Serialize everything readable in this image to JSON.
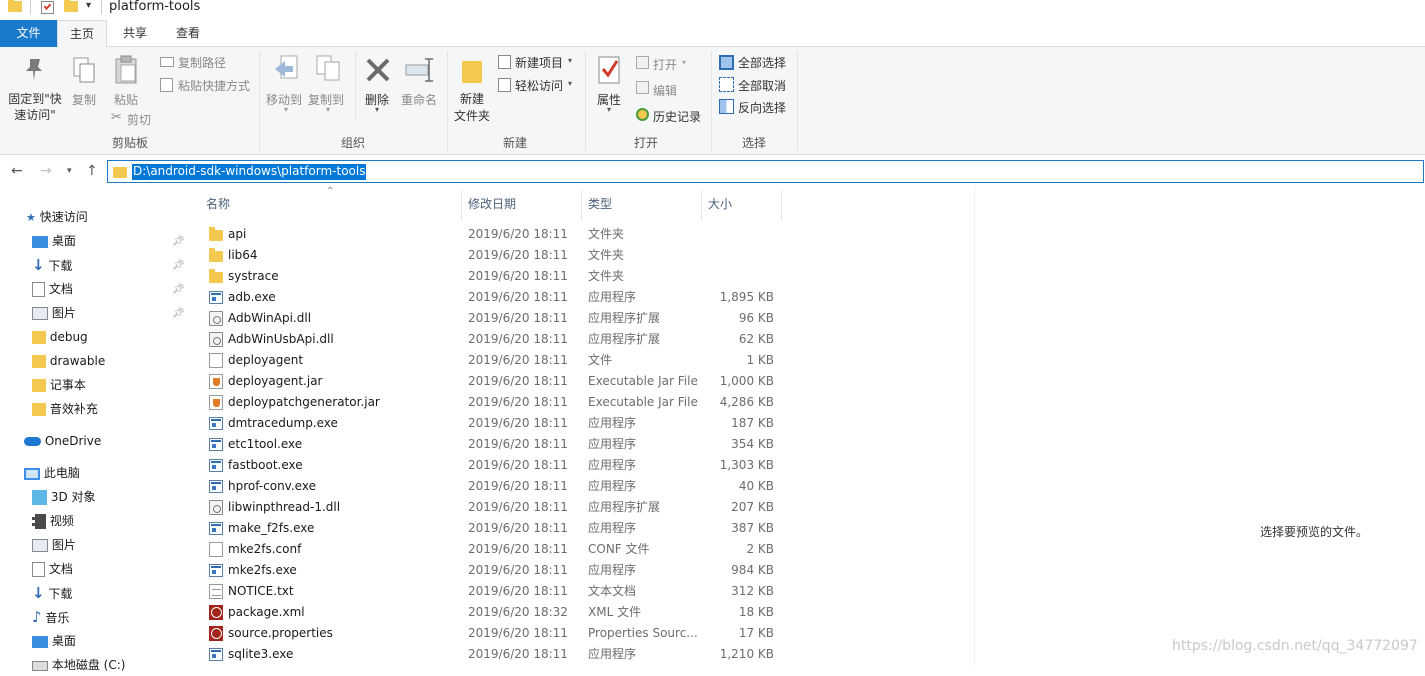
{
  "window": {
    "title": "platform-tools"
  },
  "tabs": {
    "file": "文件",
    "home": "主页",
    "share": "共享",
    "view": "查看"
  },
  "ribbon": {
    "clipboard": {
      "pin": "固定到\"快速访问\"",
      "copy": "复制",
      "paste": "粘贴",
      "copy_path": "复制路径",
      "paste_shortcut": "粘贴快捷方式",
      "cut": "剪切",
      "label": "剪贴板"
    },
    "organize": {
      "move_to": "移动到",
      "copy_to": "复制到",
      "delete": "删除",
      "rename": "重命名",
      "label": "组织"
    },
    "new": {
      "new_folder": "新建\n文件夹",
      "new_item": "新建项目",
      "easy_access": "轻松访问",
      "label": "新建"
    },
    "open": {
      "properties": "属性",
      "open": "打开",
      "edit": "编辑",
      "history": "历史记录",
      "label": "打开"
    },
    "select": {
      "select_all": "全部选择",
      "select_none": "全部取消",
      "invert": "反向选择",
      "label": "选择"
    }
  },
  "address": {
    "path": "D:\\android-sdk-windows\\platform-tools"
  },
  "sidebar": {
    "quick_access": "快速访问",
    "items": [
      "桌面",
      "下载",
      "文档",
      "图片",
      "debug",
      "drawable",
      "记事本",
      "音效补充"
    ],
    "onedrive": "OneDrive",
    "this_pc": "此电脑",
    "pc_items": [
      "3D 对象",
      "视频",
      "图片",
      "文档",
      "下载",
      "音乐",
      "桌面",
      "本地磁盘 (C:)"
    ]
  },
  "columns": {
    "name": "名称",
    "date": "修改日期",
    "type": "类型",
    "size": "大小"
  },
  "files": [
    {
      "name": "api",
      "date": "2019/6/20 18:11",
      "type": "文件夹",
      "size": "",
      "icon": "folder"
    },
    {
      "name": "lib64",
      "date": "2019/6/20 18:11",
      "type": "文件夹",
      "size": "",
      "icon": "folder"
    },
    {
      "name": "systrace",
      "date": "2019/6/20 18:11",
      "type": "文件夹",
      "size": "",
      "icon": "folder"
    },
    {
      "name": "adb.exe",
      "date": "2019/6/20 18:11",
      "type": "应用程序",
      "size": "1,895 KB",
      "icon": "exe"
    },
    {
      "name": "AdbWinApi.dll",
      "date": "2019/6/20 18:11",
      "type": "应用程序扩展",
      "size": "96 KB",
      "icon": "dll"
    },
    {
      "name": "AdbWinUsbApi.dll",
      "date": "2019/6/20 18:11",
      "type": "应用程序扩展",
      "size": "62 KB",
      "icon": "dll"
    },
    {
      "name": "deployagent",
      "date": "2019/6/20 18:11",
      "type": "文件",
      "size": "1 KB",
      "icon": "file"
    },
    {
      "name": "deployagent.jar",
      "date": "2019/6/20 18:11",
      "type": "Executable Jar File",
      "size": "1,000 KB",
      "icon": "jar"
    },
    {
      "name": "deploypatchgenerator.jar",
      "date": "2019/6/20 18:11",
      "type": "Executable Jar File",
      "size": "4,286 KB",
      "icon": "jar"
    },
    {
      "name": "dmtracedump.exe",
      "date": "2019/6/20 18:11",
      "type": "应用程序",
      "size": "187 KB",
      "icon": "exe"
    },
    {
      "name": "etc1tool.exe",
      "date": "2019/6/20 18:11",
      "type": "应用程序",
      "size": "354 KB",
      "icon": "exe"
    },
    {
      "name": "fastboot.exe",
      "date": "2019/6/20 18:11",
      "type": "应用程序",
      "size": "1,303 KB",
      "icon": "exe"
    },
    {
      "name": "hprof-conv.exe",
      "date": "2019/6/20 18:11",
      "type": "应用程序",
      "size": "40 KB",
      "icon": "exe"
    },
    {
      "name": "libwinpthread-1.dll",
      "date": "2019/6/20 18:11",
      "type": "应用程序扩展",
      "size": "207 KB",
      "icon": "dll"
    },
    {
      "name": "make_f2fs.exe",
      "date": "2019/6/20 18:11",
      "type": "应用程序",
      "size": "387 KB",
      "icon": "exe"
    },
    {
      "name": "mke2fs.conf",
      "date": "2019/6/20 18:11",
      "type": "CONF 文件",
      "size": "2 KB",
      "icon": "file"
    },
    {
      "name": "mke2fs.exe",
      "date": "2019/6/20 18:11",
      "type": "应用程序",
      "size": "984 KB",
      "icon": "exe"
    },
    {
      "name": "NOTICE.txt",
      "date": "2019/6/20 18:11",
      "type": "文本文档",
      "size": "312 KB",
      "icon": "txt"
    },
    {
      "name": "package.xml",
      "date": "2019/6/20 18:32",
      "type": "XML 文件",
      "size": "18 KB",
      "icon": "xml"
    },
    {
      "name": "source.properties",
      "date": "2019/6/20 18:11",
      "type": "Properties Sourc...",
      "size": "17 KB",
      "icon": "xml"
    },
    {
      "name": "sqlite3.exe",
      "date": "2019/6/20 18:11",
      "type": "应用程序",
      "size": "1,210 KB",
      "icon": "exe"
    }
  ],
  "preview": {
    "empty_text": "选择要预览的文件。"
  },
  "watermark": "https://blog.csdn.net/qq_34772097"
}
